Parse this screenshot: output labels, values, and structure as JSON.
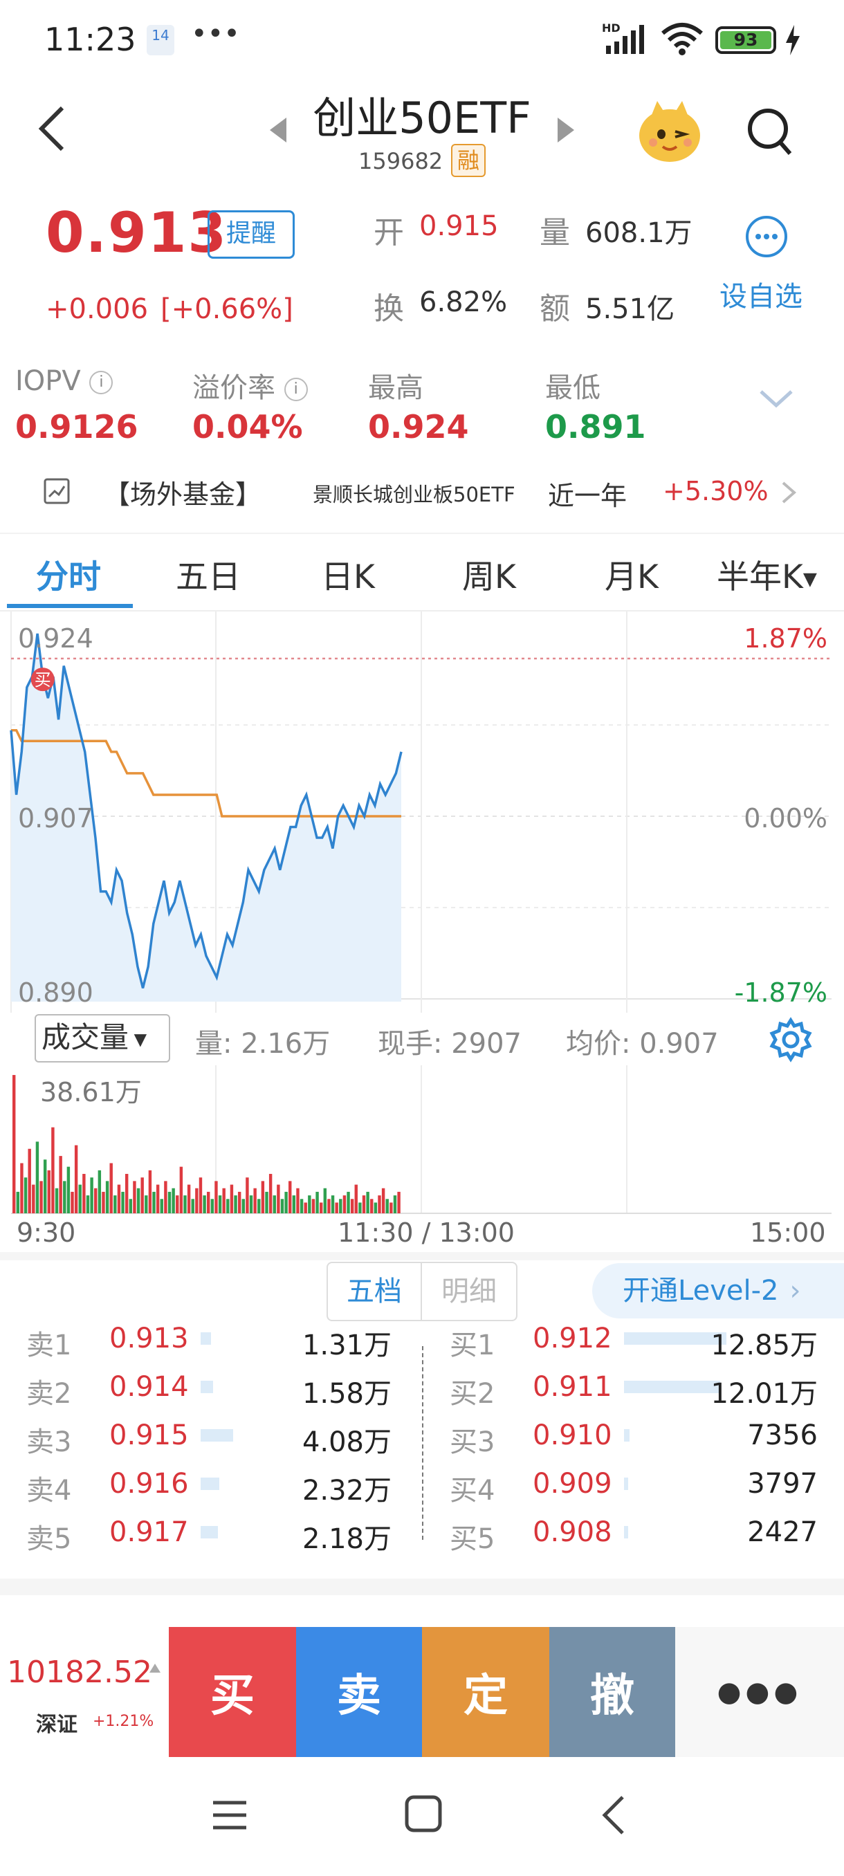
{
  "status_bar": {
    "time": "11:23",
    "calendar_day": "14",
    "battery": "93"
  },
  "header": {
    "title": "创业50ETF",
    "code": "159682",
    "badge": "融"
  },
  "quote": {
    "price": "0.913",
    "alert_label": "提醒",
    "change": "+0.006",
    "change_pct": "[+0.66%]",
    "open_label": "开",
    "open": "0.915",
    "volume_label": "量",
    "volume": "608.1万",
    "turnover_label": "换",
    "turnover": "6.82%",
    "amount_label": "额",
    "amount": "5.51亿",
    "watchlist_label": "设自选"
  },
  "stats": [
    {
      "label": "IOPV",
      "value": "0.9126"
    },
    {
      "label": "溢价率",
      "value": "0.04%"
    },
    {
      "label": "最高",
      "value": "0.924"
    },
    {
      "label": "最低",
      "value": "0.891"
    }
  ],
  "fund_link": {
    "tag": "【场外基金】",
    "name": "景顺长城创业板50ETF",
    "period": "近一年",
    "return": "+5.30%"
  },
  "chart_tabs": [
    "分时",
    "五日",
    "日K",
    "周K",
    "月K",
    "半年K"
  ],
  "chart_data": {
    "type": "line",
    "y_labels_left": [
      "0.924",
      "0.907",
      "0.890"
    ],
    "y_labels_right": [
      "1.87%",
      "0.00%",
      "-1.87%"
    ],
    "ylim": [
      0.89,
      0.924
    ],
    "prev_close": 0.907,
    "marker": "买",
    "series": [
      {
        "values": [
          0.915,
          0.909,
          0.913,
          0.919,
          0.92,
          0.924,
          0.92,
          0.918,
          0.92,
          0.916,
          0.921,
          0.919,
          0.917,
          0.915,
          0.913,
          0.909,
          0.905,
          0.9,
          0.9,
          0.899,
          0.902,
          0.901,
          0.898,
          0.896,
          0.893,
          0.891,
          0.893,
          0.897,
          0.899,
          0.901,
          0.898,
          0.899,
          0.901,
          0.899,
          0.897,
          0.895,
          0.896,
          0.894,
          0.893,
          0.892,
          0.894,
          0.896,
          0.895,
          0.897,
          0.899,
          0.902,
          0.901,
          0.9,
          0.902,
          0.903,
          0.904,
          0.902,
          0.904,
          0.906,
          0.906,
          0.908,
          0.909,
          0.907,
          0.905,
          0.905,
          0.906,
          0.904,
          0.907,
          0.908,
          0.907,
          0.906,
          0.908,
          0.907,
          0.909,
          0.908,
          0.91,
          0.909,
          0.91,
          0.911,
          0.913
        ]
      },
      {
        "values": [
          0.915,
          0.915,
          0.914,
          0.914,
          0.914,
          0.914,
          0.914,
          0.914,
          0.914,
          0.914,
          0.914,
          0.914,
          0.914,
          0.914,
          0.914,
          0.914,
          0.914,
          0.914,
          0.914,
          0.913,
          0.913,
          0.912,
          0.911,
          0.911,
          0.911,
          0.911,
          0.91,
          0.909,
          0.909,
          0.909,
          0.909,
          0.909,
          0.909,
          0.909,
          0.909,
          0.909,
          0.909,
          0.909,
          0.909,
          0.909,
          0.907,
          0.907,
          0.907,
          0.907,
          0.907,
          0.907,
          0.907,
          0.907,
          0.907,
          0.907,
          0.907,
          0.907,
          0.907,
          0.907,
          0.907,
          0.907,
          0.907,
          0.907,
          0.907,
          0.907,
          0.907,
          0.907,
          0.907,
          0.907,
          0.907,
          0.907,
          0.907,
          0.907,
          0.907,
          0.907,
          0.907,
          0.907,
          0.907,
          0.907,
          0.907
        ]
      }
    ],
    "volume": {
      "max": 38.61,
      "unit": "万",
      "bars": [
        38.6,
        6,
        14,
        10,
        18,
        8,
        20,
        9,
        15,
        12,
        24,
        7,
        16,
        9,
        13,
        6,
        19,
        8,
        11,
        5,
        10,
        7,
        12,
        6,
        9,
        14,
        5,
        8,
        6,
        11,
        4,
        9,
        7,
        10,
        5,
        12,
        6,
        8,
        4,
        9,
        6,
        7,
        5,
        13,
        5,
        8,
        4,
        7,
        10,
        5,
        6,
        4,
        9,
        5,
        7,
        4,
        8,
        5,
        6,
        4,
        10,
        5,
        7,
        4,
        9,
        6,
        11,
        5,
        8,
        4,
        6,
        9,
        5,
        7,
        4,
        3,
        5,
        4,
        6,
        3,
        7,
        4,
        5,
        3,
        4,
        5,
        6,
        4,
        8,
        3,
        5,
        6,
        4,
        3,
        5,
        7,
        4,
        3,
        5,
        6
      ],
      "colors": [
        "r",
        "g",
        "r",
        "g",
        "r",
        "r",
        "g",
        "r",
        "g",
        "r",
        "r",
        "g",
        "r",
        "g",
        "g",
        "r",
        "r",
        "g",
        "r",
        "g",
        "g",
        "r",
        "g",
        "r",
        "g",
        "r",
        "g",
        "r",
        "g",
        "r",
        "g",
        "r",
        "g",
        "r",
        "g",
        "r",
        "g",
        "r",
        "g",
        "r",
        "g",
        "g",
        "r",
        "r",
        "g",
        "r",
        "g",
        "r",
        "r",
        "g",
        "r",
        "g",
        "r",
        "g",
        "r",
        "g",
        "r",
        "g",
        "r",
        "g",
        "r",
        "g",
        "r",
        "g",
        "r",
        "g",
        "r",
        "g",
        "r",
        "g",
        "g",
        "r",
        "g",
        "r",
        "g",
        "r",
        "g",
        "r",
        "g",
        "r",
        "g",
        "r",
        "g",
        "r",
        "g",
        "r",
        "g",
        "r",
        "r",
        "g",
        "r",
        "g",
        "r",
        "g",
        "r",
        "r",
        "g",
        "r",
        "g",
        "r"
      ]
    }
  },
  "volume": {
    "selector": "成交量",
    "summary": "量: 2.16万",
    "current_hand": "现手: 2907",
    "avg_price": "均价: 0.907",
    "max_label": "38.61万",
    "time_labels": [
      "9:30",
      "11:30 / 13:00",
      "15:00"
    ]
  },
  "order_book": {
    "tabs": [
      "五档",
      "明细"
    ],
    "level2_label": "开通Level-2",
    "sell": [
      {
        "label": "卖1",
        "price": "0.913",
        "volume": "1.31万",
        "size": 1.31
      },
      {
        "label": "卖2",
        "price": "0.914",
        "volume": "1.58万",
        "size": 1.58
      },
      {
        "label": "卖3",
        "price": "0.915",
        "volume": "4.08万",
        "size": 4.08
      },
      {
        "label": "卖4",
        "price": "0.916",
        "volume": "2.32万",
        "size": 2.32
      },
      {
        "label": "卖5",
        "price": "0.917",
        "volume": "2.18万",
        "size": 2.18
      }
    ],
    "buy": [
      {
        "label": "买1",
        "price": "0.912",
        "volume": "12.85万",
        "size": 12.85
      },
      {
        "label": "买2",
        "price": "0.911",
        "volume": "12.01万",
        "size": 12.01
      },
      {
        "label": "买3",
        "price": "0.910",
        "volume": "7356",
        "size": 0.7356
      },
      {
        "label": "买4",
        "price": "0.909",
        "volume": "3797",
        "size": 0.3797
      },
      {
        "label": "买5",
        "price": "0.908",
        "volume": "2427",
        "size": 0.2427
      }
    ]
  },
  "ticker": {
    "value": "10182.52",
    "name": "深证",
    "change": "+1.21%"
  },
  "trade_buttons": [
    "买",
    "卖",
    "定",
    "撤"
  ]
}
